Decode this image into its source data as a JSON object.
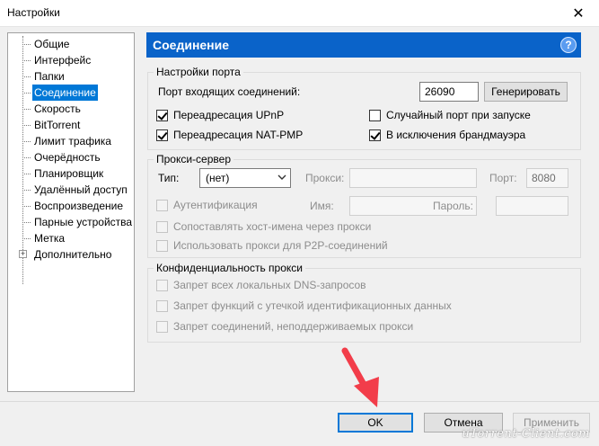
{
  "window": {
    "title": "Настройки",
    "close_glyph": "✕"
  },
  "sidebar": {
    "items": [
      {
        "label": "Общие"
      },
      {
        "label": "Интерфейс"
      },
      {
        "label": "Папки"
      },
      {
        "label": "Соединение",
        "selected": true
      },
      {
        "label": "Скорость"
      },
      {
        "label": "BitTorrent"
      },
      {
        "label": "Лимит трафика"
      },
      {
        "label": "Очерёдность"
      },
      {
        "label": "Планировщик"
      },
      {
        "label": "Удалённый доступ"
      },
      {
        "label": "Воспроизведение"
      },
      {
        "label": "Парные устройства"
      },
      {
        "label": "Метка"
      },
      {
        "label": "Дополнительно",
        "expandable": true
      }
    ],
    "expander_glyph": "+"
  },
  "header": {
    "title": "Соединение",
    "help_glyph": "?"
  },
  "port": {
    "group_title": "Настройки порта",
    "incoming_label": "Порт входящих соединений:",
    "incoming_value": "26090",
    "generate_label": "Генерировать",
    "upnp_label": "Переадресация UPnP",
    "upnp_checked": true,
    "natpmp_label": "Переадресация NAT-PMP",
    "natpmp_checked": true,
    "random_label": "Случайный порт при запуске",
    "random_checked": false,
    "firewall_label": "В исключения брандмауэра",
    "firewall_checked": true
  },
  "proxy": {
    "group_title": "Прокси-сервер",
    "type_label": "Тип:",
    "type_value": "(нет)",
    "proxy_label": "Прокси:",
    "proxy_value": "",
    "port_label": "Порт:",
    "port_value": "8080",
    "auth_label": "Аутентификация",
    "name_label": "Имя:",
    "password_label": "Пароль:",
    "resolve_label": "Сопоставлять хост-имена через прокси",
    "p2p_label": "Использовать прокси для P2P-соединений"
  },
  "privacy": {
    "group_title": "Конфиденциальность прокси",
    "dns_label": "Запрет всех локальных DNS-запросов",
    "leak_label": "Запрет функций с утечкой идентификационных данных",
    "unsupported_label": "Запрет соединений, неподдерживаемых прокси"
  },
  "footer": {
    "ok_label": "OK",
    "cancel_label": "Отмена",
    "apply_label": "Применить"
  },
  "watermark": "uTorrent-Client.com",
  "colors": {
    "header_bg": "#0a63c9",
    "selection": "#0078d7",
    "annotation": "#f23d4a"
  }
}
